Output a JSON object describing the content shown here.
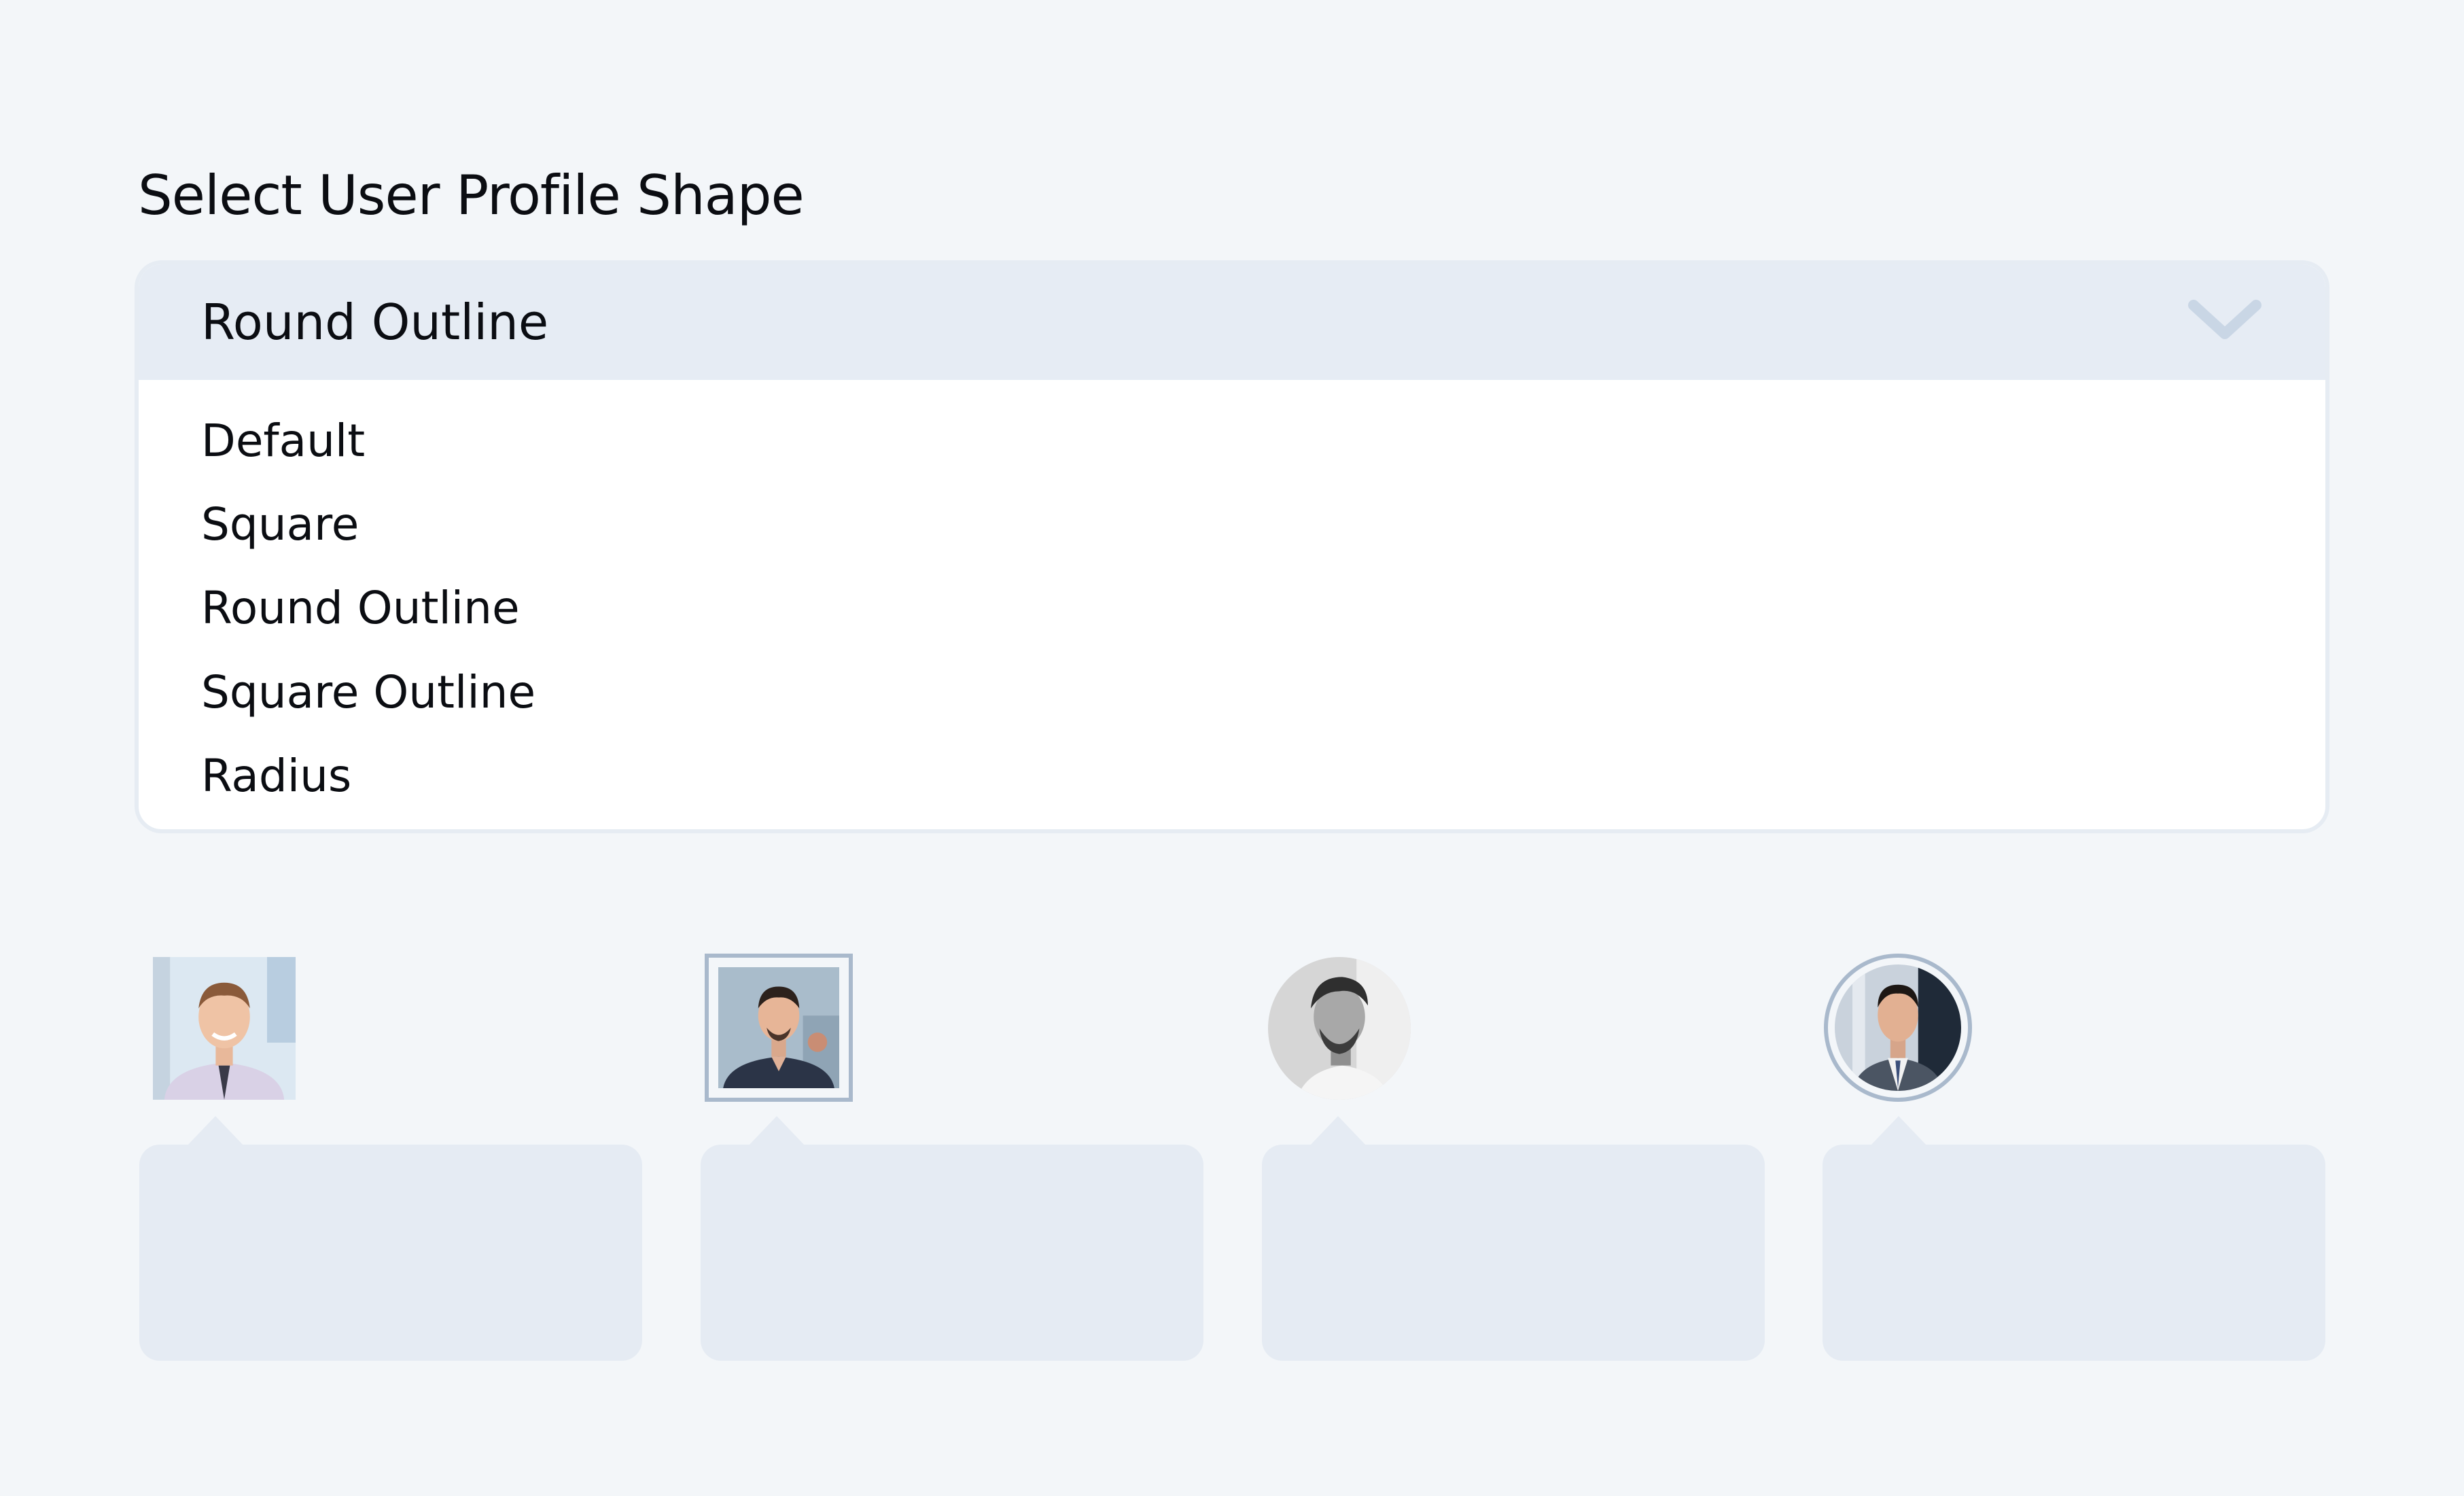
{
  "page_title": "Select User Profile Shape",
  "dropdown": {
    "selected": "Round Outline",
    "toggle_icon": "chevron-down-icon",
    "options": [
      "Default",
      "Square",
      "Round Outline",
      "Square Outline",
      "Radius"
    ]
  },
  "avatars": [
    {
      "shape": "Default"
    },
    {
      "shape": "Square Outline"
    },
    {
      "shape": "Round"
    },
    {
      "shape": "Round Outline"
    }
  ],
  "colors": {
    "background": "#f3f6f9",
    "dropdown_header": "#e6ecf4",
    "card": "#e5ebf3",
    "outline": "#a9b9cc",
    "text": "#0b0d12"
  }
}
